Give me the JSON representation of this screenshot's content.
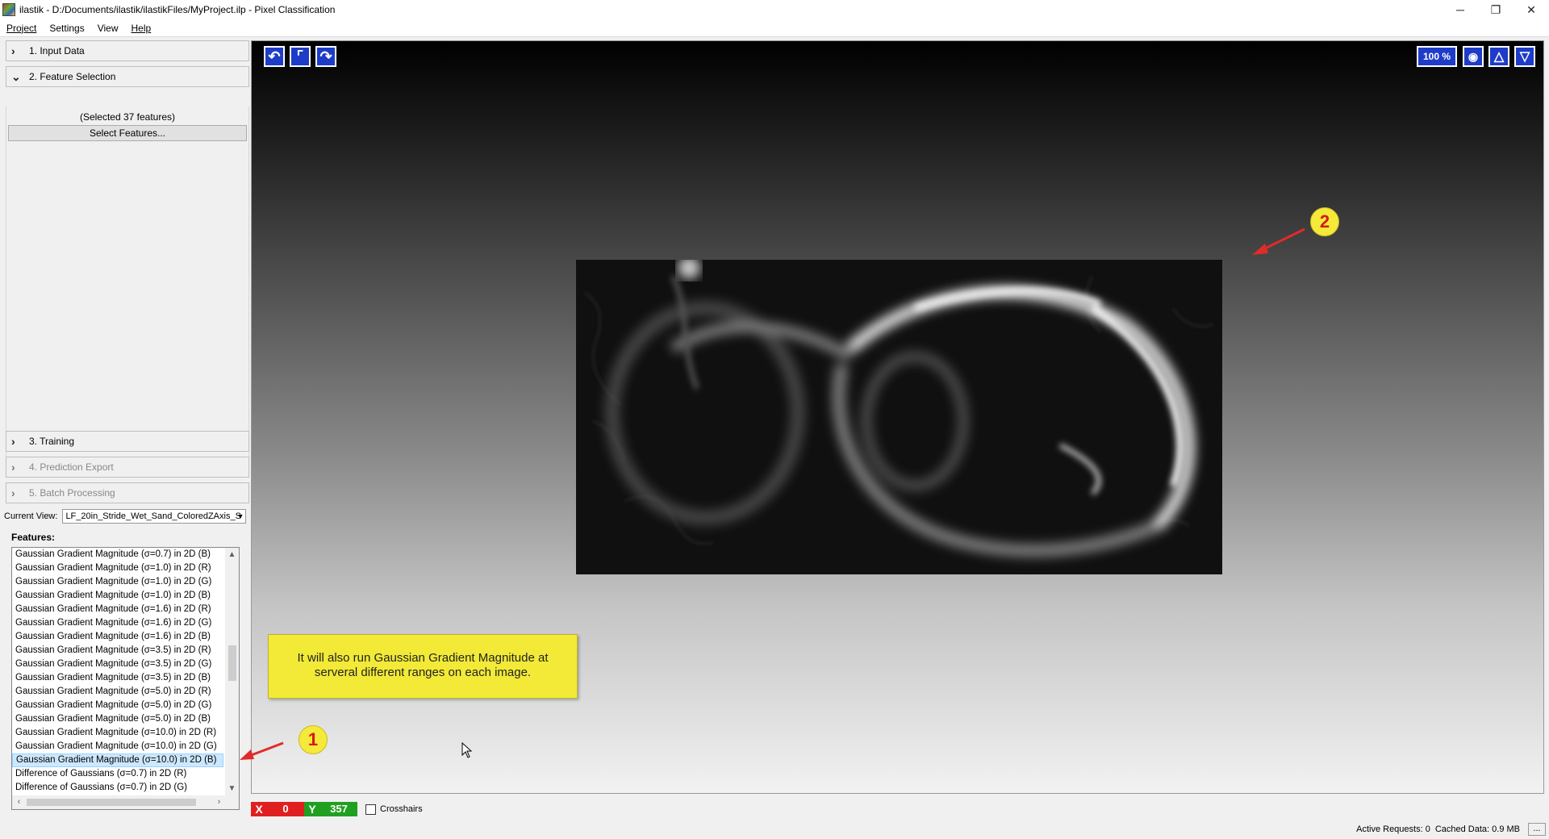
{
  "window": {
    "title": "ilastik - D:/Documents/ilastik/ilastikFiles/MyProject.ilp - Pixel Classification",
    "minimize": "─",
    "restore": "❐",
    "close": "✕"
  },
  "menu": {
    "project": "Project",
    "settings": "Settings",
    "view": "View",
    "help": "Help"
  },
  "applets": {
    "input_data": "1. Input Data",
    "feature_selection": "2. Feature Selection",
    "training": "3. Training",
    "prediction_export": "4. Prediction Export",
    "batch_processing": "5. Batch Processing"
  },
  "feature_selection": {
    "count_text": "(Selected 37 features)",
    "select_button": "Select Features..."
  },
  "current_view": {
    "label": "Current View:",
    "value": "LF_20in_Stride_Wet_Sand_ColoredZAxis_S"
  },
  "features": {
    "label": "Features:",
    "items": [
      "Gaussian Gradient Magnitude (σ=0.7) in 2D (B)",
      "Gaussian Gradient Magnitude (σ=1.0) in 2D (R)",
      "Gaussian Gradient Magnitude (σ=1.0) in 2D (G)",
      "Gaussian Gradient Magnitude (σ=1.0) in 2D (B)",
      "Gaussian Gradient Magnitude (σ=1.6) in 2D (R)",
      "Gaussian Gradient Magnitude (σ=1.6) in 2D (G)",
      "Gaussian Gradient Magnitude (σ=1.6) in 2D (B)",
      "Gaussian Gradient Magnitude (σ=3.5) in 2D (R)",
      "Gaussian Gradient Magnitude (σ=3.5) in 2D (G)",
      "Gaussian Gradient Magnitude (σ=3.5) in 2D (B)",
      "Gaussian Gradient Magnitude (σ=5.0) in 2D (R)",
      "Gaussian Gradient Magnitude (σ=5.0) in 2D (G)",
      "Gaussian Gradient Magnitude (σ=5.0) in 2D (B)",
      "Gaussian Gradient Magnitude (σ=10.0) in 2D (R)",
      "Gaussian Gradient Magnitude (σ=10.0) in 2D (G)",
      "Gaussian Gradient Magnitude (σ=10.0) in 2D (B)",
      "Difference of Gaussians (σ=0.7) in 2D (R)",
      "Difference of Gaussians (σ=0.7) in 2D (G)"
    ],
    "selected_index": 15
  },
  "viewer": {
    "zoom": "100 %",
    "undo_icon": "↶",
    "redo_icon": "↷",
    "fit_icon": "⌜",
    "camera_icon": "◉",
    "up_icon": "△",
    "down_icon": "▽"
  },
  "annotation": {
    "callout_line1": "It will also run Gaussian Gradient Magnitude at",
    "callout_line2": "serveral different ranges  on each image.",
    "badge1": "1",
    "badge2": "2",
    "accent": "#f2ea37",
    "arrow_color": "#e02b2b"
  },
  "coords": {
    "x_label": "X",
    "x_value": "0",
    "y_label": "Y",
    "y_value": "357",
    "crosshairs": "Crosshairs"
  },
  "status": {
    "active_requests": "Active Requests: 0",
    "cached_data": "Cached Data: 0.9 MB",
    "more": "..."
  },
  "colors": {
    "tool_blue": "#1e3cc8",
    "x_red": "#e02020",
    "y_green": "#20a020"
  }
}
